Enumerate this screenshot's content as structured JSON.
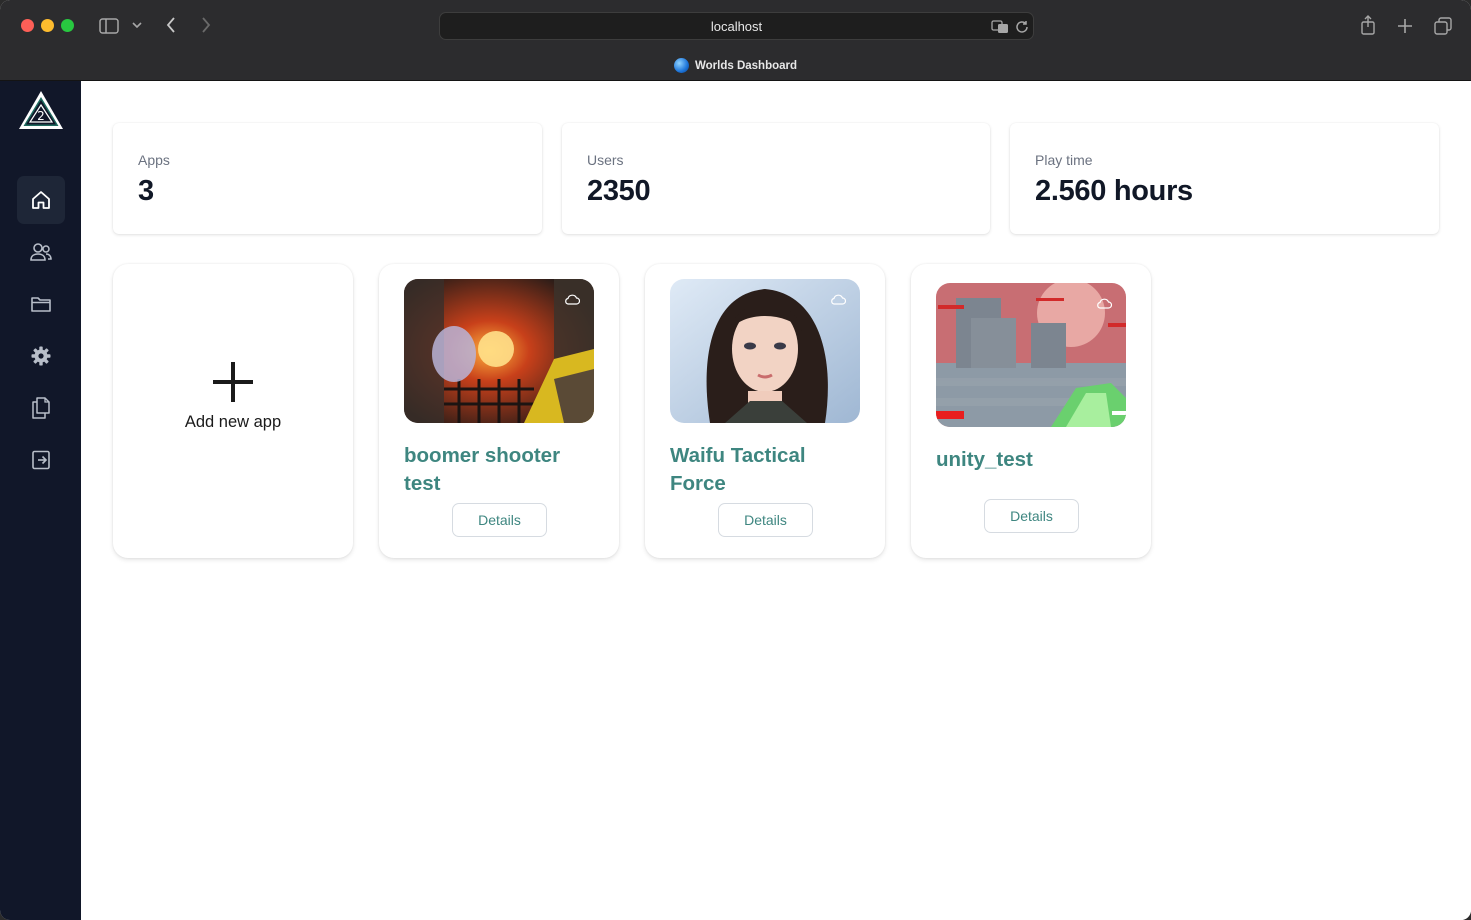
{
  "browser": {
    "url": "localhost",
    "tab_title": "Worlds Dashboard"
  },
  "sidebar": {
    "items": [
      {
        "name": "home",
        "active": true
      },
      {
        "name": "users"
      },
      {
        "name": "folder"
      },
      {
        "name": "settings"
      },
      {
        "name": "documents"
      },
      {
        "name": "logout"
      }
    ]
  },
  "stats": {
    "apps": {
      "label": "Apps",
      "value": "3"
    },
    "users": {
      "label": "Users",
      "value": "2350"
    },
    "playtime": {
      "label": "Play time",
      "value": "2.560 hours"
    }
  },
  "add_app": {
    "label": "Add new app"
  },
  "apps": [
    {
      "title": "boomer shooter test",
      "details_label": "Details",
      "thumbnail": "boomer-shooter-screenshot"
    },
    {
      "title": "Waifu Tactical Force",
      "details_label": "Details",
      "thumbnail": "anime-character-portrait"
    },
    {
      "title": "unity_test",
      "details_label": "Details",
      "thumbnail": "unity-fps-screenshot"
    }
  ],
  "colors": {
    "sidebar_bg": "#111729",
    "accent": "#3e8680",
    "chrome_bg": "#2c2c2e"
  }
}
